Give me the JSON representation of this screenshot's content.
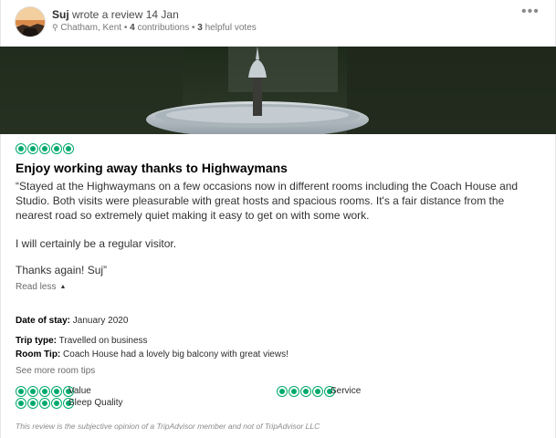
{
  "reviewer": {
    "name": "Suj",
    "action_text": "wrote a review 14 Jan",
    "location": "Chatham, Kent",
    "contributions_count": "4",
    "contributions_label": "contributions",
    "helpful_count": "3",
    "helpful_label": "helpful votes",
    "more_options": "•••"
  },
  "review": {
    "rating": 5,
    "title": "Enjoy working away thanks to Highwaymans",
    "paragraph_1": "“Stayed at the Highwaymans on a few occasions now in different rooms including the Coach House and Studio. Both visits were pleasurable with great hosts and spacious rooms. It's a fair distance from the nearest road so extremely quiet making it easy to get on with some work.",
    "paragraph_2": "I will certainly be a regular visitor.",
    "paragraph_3": "Thanks again! Suj”",
    "read_less": "Read less",
    "date_of_stay_label": "Date of stay:",
    "date_of_stay_value": "January 2020",
    "trip_type_label": "Trip type:",
    "trip_type_value": "Travelled on business",
    "room_tip_label": "Room Tip:",
    "room_tip_value": "Coach House had a lovely big balcony with great views!",
    "see_more_tips": "See more room tips"
  },
  "sub_ratings": [
    {
      "label": "Value",
      "rating": 5
    },
    {
      "label": "Service",
      "rating": 5
    },
    {
      "label": "Sleep Quality",
      "rating": 5
    }
  ],
  "disclaimer": "This review is the subjective opinion of a TripAdvisor member and not of TripAdvisor LLC",
  "colors": {
    "bubble_green": "#00aa6c",
    "text_dark": "#2c2c2c",
    "text_muted": "#777777"
  }
}
